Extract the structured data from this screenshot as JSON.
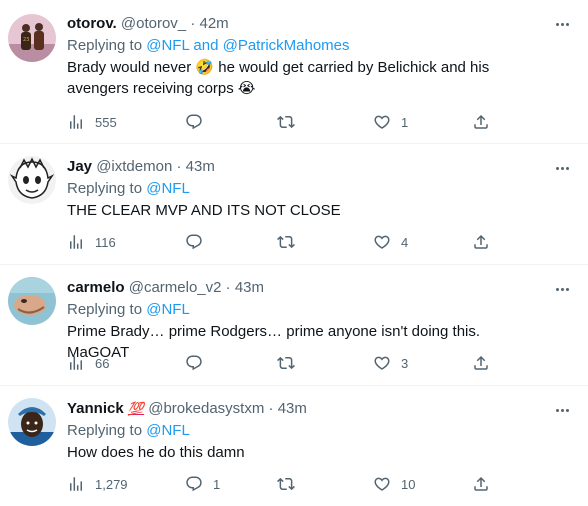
{
  "tweets": [
    {
      "name": "otorov.",
      "handle": "@otorov_",
      "time": "42m",
      "badge": "",
      "replying_prefix": "Replying to ",
      "mentions": "@NFL and @PatrickMahomes",
      "text": "Brady would never 🤣 he would get carried by Belichick and his avengers receiving corps 😭",
      "views": "555",
      "replies": "",
      "retweets": "",
      "likes": "1",
      "avatar_color": "#c9a3b5"
    },
    {
      "name": "Jay",
      "handle": "@ixtdemon",
      "time": "43m",
      "badge": "",
      "replying_prefix": "Replying to ",
      "mentions": "@NFL",
      "text": "THE CLEAR MVP AND ITS NOT CLOSE",
      "views": "116",
      "replies": "",
      "retweets": "",
      "likes": "4",
      "avatar_color": "#e9e9e9"
    },
    {
      "name": "carmelo",
      "handle": "@carmelo_v2",
      "time": "43m",
      "badge": "",
      "replying_prefix": "Replying to ",
      "mentions": "@NFL",
      "text": "Prime Brady… prime Rodgers… prime anyone isn't doing this. MaGOAT",
      "views": "66",
      "replies": "",
      "retweets": "",
      "likes": "3",
      "avatar_color": "#7fb4c9"
    },
    {
      "name": "Yannick",
      "handle": "@brokedasystxm",
      "time": "43m",
      "badge": "💯",
      "replying_prefix": "Replying to ",
      "mentions": "@NFL",
      "text": "How does he do this damn",
      "views": "1,279",
      "replies": "1",
      "retweets": "",
      "likes": "10",
      "avatar_color": "#2f6fa8"
    }
  ],
  "separator": "·",
  "icons": [
    "views-icon",
    "reply-icon",
    "retweet-icon",
    "like-icon",
    "share-icon",
    "more-icon"
  ],
  "colors": {
    "text_primary": "#0f1419",
    "text_secondary": "#536471",
    "link": "#1d9bf0",
    "divider": "#eff3f4"
  }
}
